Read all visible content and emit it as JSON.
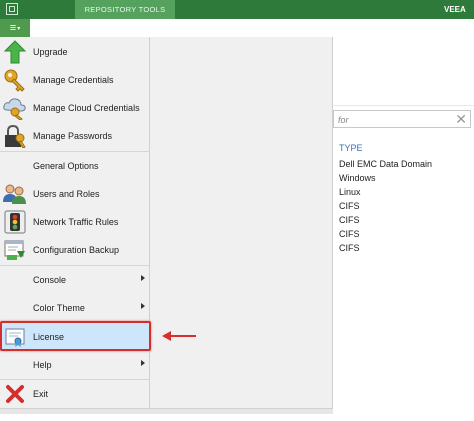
{
  "titlebar": {
    "tab_label": "REPOSITORY TOOLS",
    "brand_text": "VEEA",
    "color": "#2d7a3a"
  },
  "menu_button": {
    "glyph": "≡",
    "caret": "▾"
  },
  "search": {
    "placeholder": "for"
  },
  "repo_table": {
    "header": "TYPE",
    "rows": [
      "Dell EMC Data Domain",
      "Windows",
      "Linux",
      "CIFS",
      "CIFS",
      "CIFS",
      "CIFS"
    ]
  },
  "menu": {
    "items": [
      {
        "label": "Upgrade",
        "icon": "upgrade-arrow-icon"
      },
      {
        "label": "Manage Credentials",
        "icon": "key-icon"
      },
      {
        "label": "Manage Cloud Credentials",
        "icon": "cloud-key-icon"
      },
      {
        "label": "Manage Passwords",
        "icon": "lock-key-icon"
      },
      {
        "label": "General Options",
        "icon": ""
      },
      {
        "label": "Users and Roles",
        "icon": "users-icon"
      },
      {
        "label": "Network Traffic Rules",
        "icon": "traffic-light-icon"
      },
      {
        "label": "Configuration Backup",
        "icon": "config-backup-icon"
      },
      {
        "label": "Console",
        "icon": "",
        "submenu": true
      },
      {
        "label": "Color Theme",
        "icon": "",
        "submenu": true
      },
      {
        "label": "License",
        "icon": "license-certificate-icon",
        "highlighted": true
      },
      {
        "label": "Help",
        "icon": "",
        "submenu": true
      },
      {
        "label": "Exit",
        "icon": "exit-x-icon"
      }
    ]
  },
  "annotation": {
    "highlight_color": "#d62d2d"
  }
}
